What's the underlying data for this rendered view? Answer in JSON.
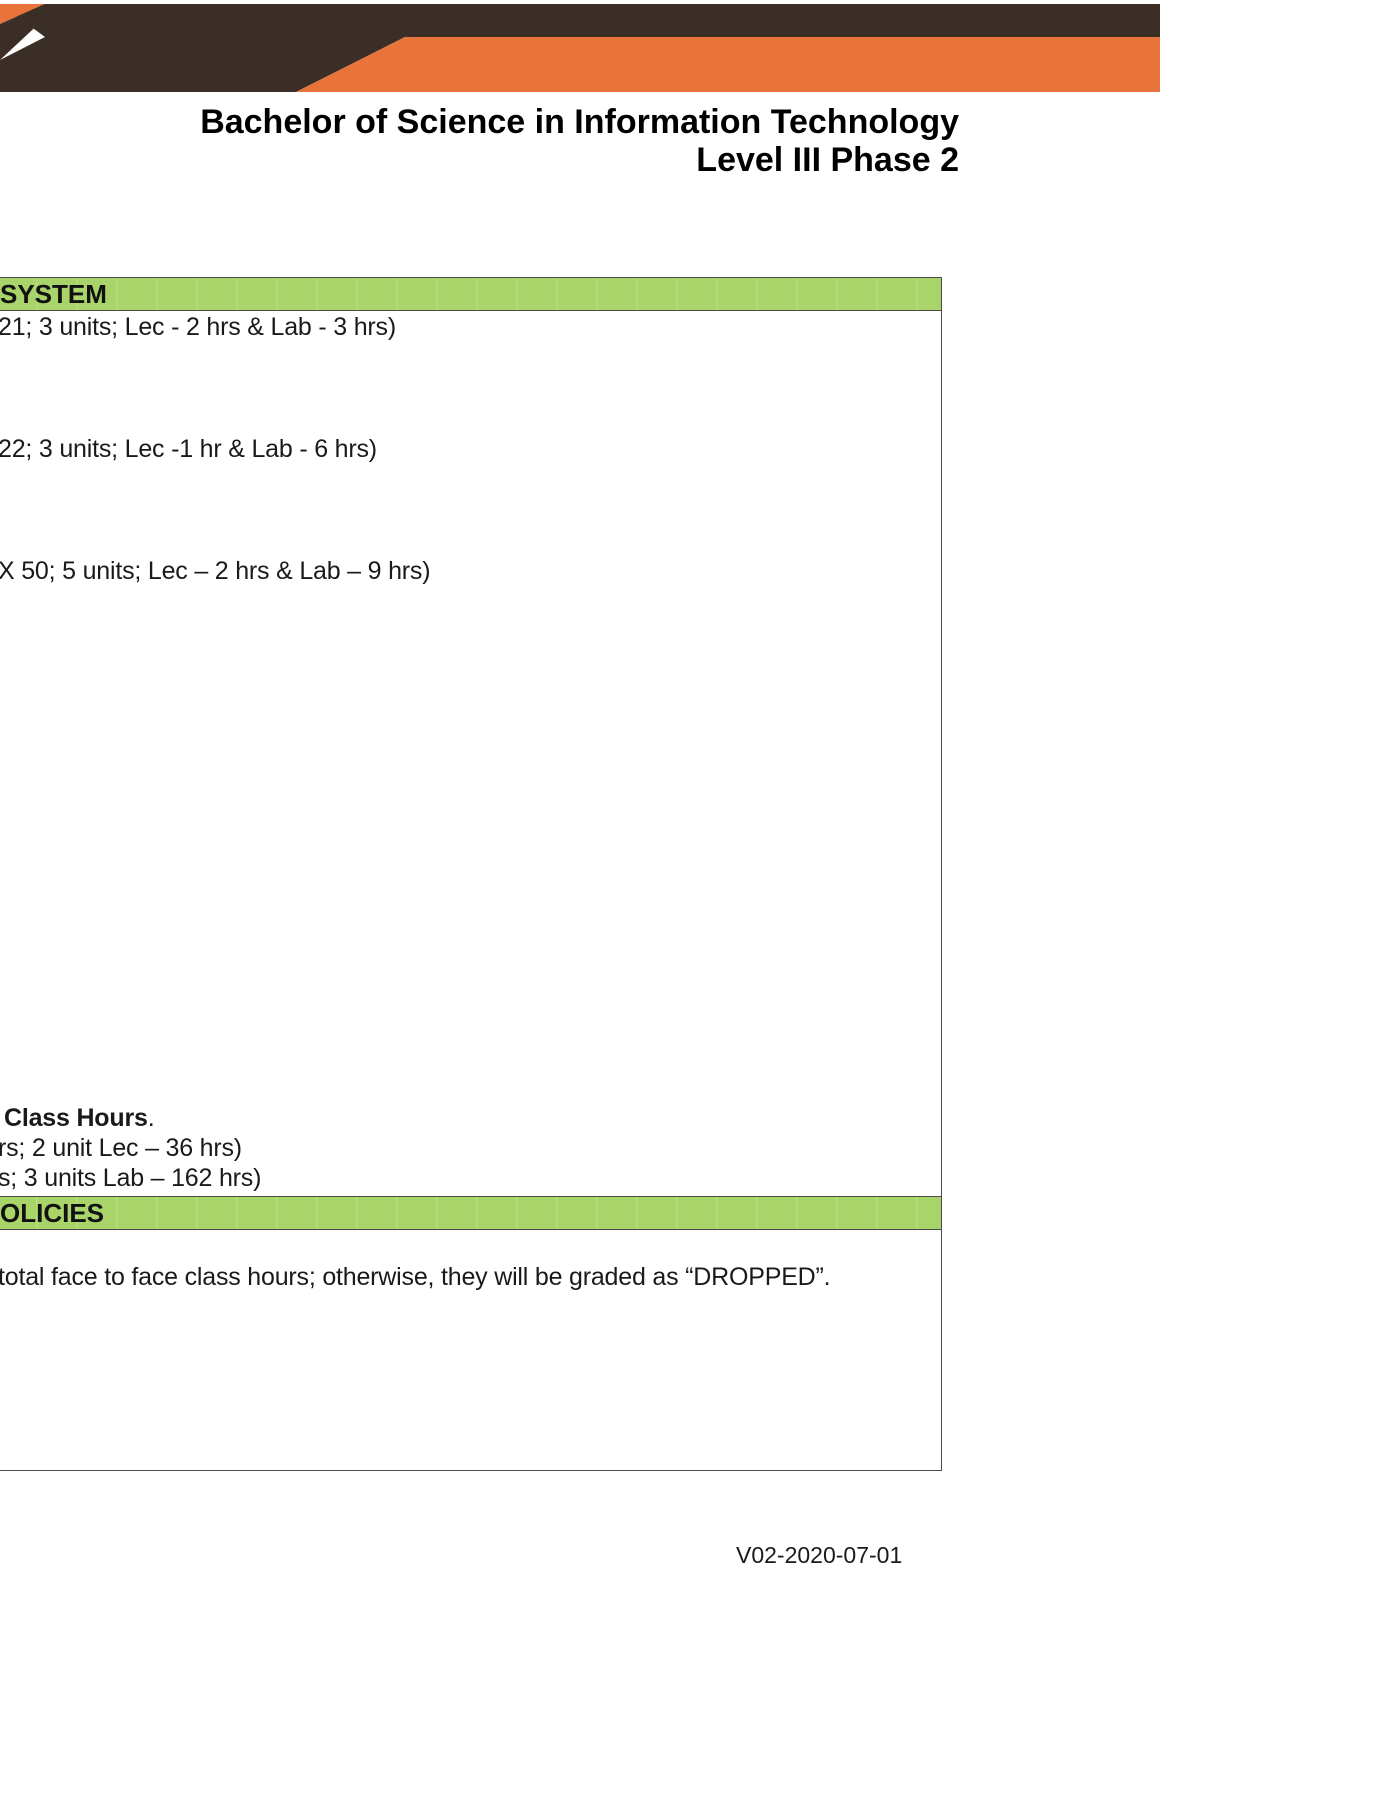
{
  "header": {
    "program_title": "Bachelor of Science in Information Technology",
    "level_phase": "Level III Phase 2",
    "banner_colors": {
      "dark": "#3b2e26",
      "accent": "#e8743b"
    }
  },
  "grading_section": {
    "header_fragment": "SYSTEM",
    "course_line_1": "21; 3 units; Lec - 2 hrs & Lab - 3 hrs)",
    "course_line_2": "22; 3 units; Lec -1 hr & Lab - 6 hrs)",
    "course_line_3": "X 50; 5 units; Lec – 2 hrs & Lab – 9 hrs)",
    "class_hours_label": "Class Hours",
    "class_hours_period": ".",
    "lec_hours_line": "rs; 2 unit Lec – 36 hrs)",
    "lab_hours_line": "s; 3 units Lab – 162 hrs)"
  },
  "policies_section": {
    "header_fragment": "OLICIES",
    "attendance_line": "total face to face class hours; otherwise, they will be graded as “DROPPED”."
  },
  "footer": {
    "version_code": "V02-2020-07-01"
  },
  "colors": {
    "section_header_bg": "#a9d46a",
    "border": "#4a4a4a"
  }
}
